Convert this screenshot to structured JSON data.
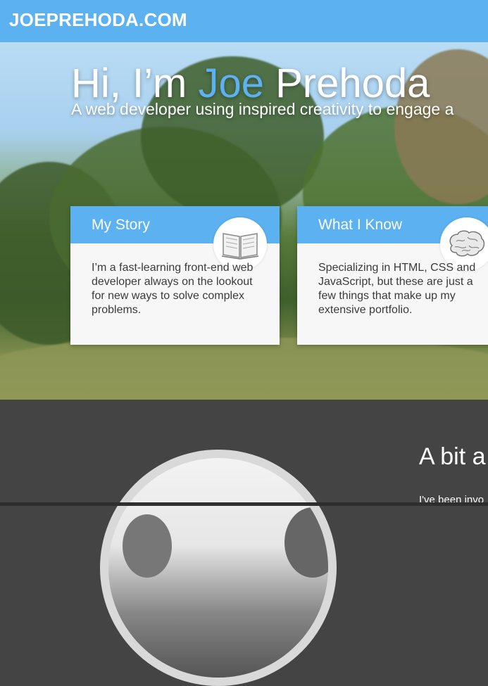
{
  "header": {
    "logo": "JOEPREHODA.COM"
  },
  "hero": {
    "title_pre": "Hi, I’m ",
    "title_accent": "Joe",
    "title_post": " Prehoda",
    "subtitle": "A web developer using inspired creativity to engage a"
  },
  "cards": [
    {
      "title": "My Story",
      "icon": "book-icon",
      "text": "I’m a fast-learning front-end web developer always on the lookout for new ways to solve complex problems."
    },
    {
      "title": "What I Know",
      "icon": "brain-icon",
      "text": "Specializing in HTML, CSS and JavaScript, but these are just a few things that make up my extensive portfolio."
    }
  ],
  "about": {
    "title": "A bit a",
    "text": "I've been invo"
  },
  "colors": {
    "accent": "#5cb1f0",
    "dark": "#444444",
    "card": "#f7f7f7"
  }
}
